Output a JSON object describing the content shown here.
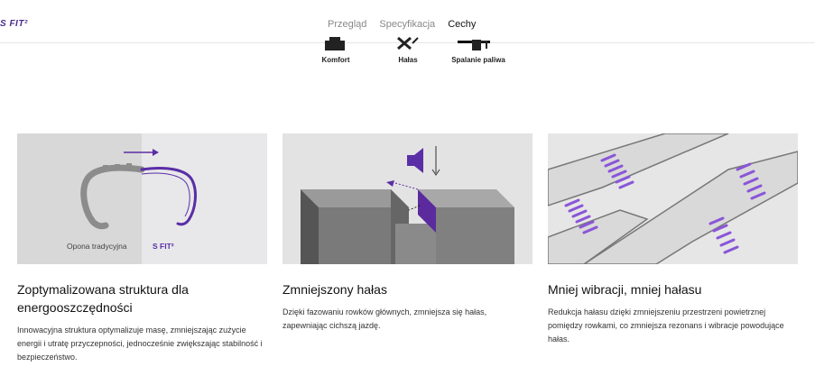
{
  "header": {
    "brand": "S FIT²",
    "tabs": [
      {
        "label": "Przegląd",
        "active": false
      },
      {
        "label": "Specyfikacja",
        "active": false
      },
      {
        "label": "Cechy",
        "active": true
      }
    ]
  },
  "features": [
    {
      "label": "Komfort",
      "icon": "comfort-icon"
    },
    {
      "label": "Hałas",
      "icon": "noise-icon"
    },
    {
      "label": "Spalanie paliwa",
      "icon": "fuel-icon"
    }
  ],
  "cards": [
    {
      "title": "Zoptymalizowana struktura dla energooszczędności",
      "text": "Innowacyjna struktura optymalizuje masę, zmniejszając zużycie energii i utratę przyczepności, jednocześnie zwiększając stabilność i bezpieczeństwo.",
      "image_labels": {
        "left": "Opona tradycyjna",
        "right": "S FIT²"
      }
    },
    {
      "title": "Zmniejszony hałas",
      "text": "Dzięki fazowaniu rowków głównych, zmniejsza się hałas, zapewniając cichszą jazdę."
    },
    {
      "title": "Mniej wibracji, mniej hałasu",
      "text": "Redukcja hałasu dzięki zmniejszeniu przestrzeni powietrznej pomiędzy rowkami, co zmniejsza rezonans i wibracje powodujące hałas."
    }
  ],
  "colors": {
    "accent": "#5a2ea6",
    "text": "#111111",
    "muted": "#888888"
  }
}
